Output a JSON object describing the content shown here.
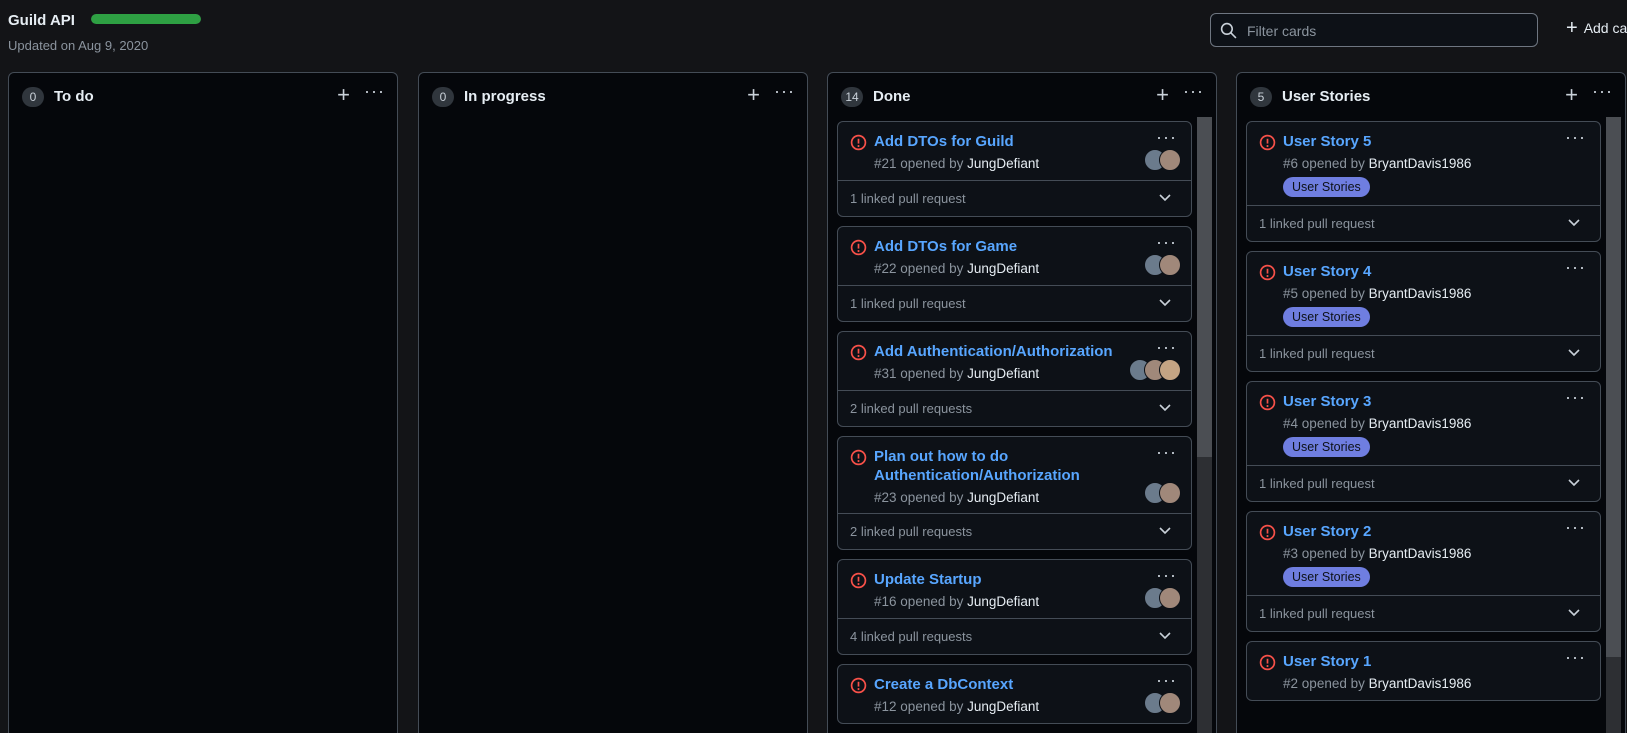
{
  "header": {
    "title": "Guild API",
    "progress": 1.0,
    "updated": "Updated on Aug 9, 2020",
    "filter_placeholder": "Filter cards",
    "add_cards": "Add cards"
  },
  "colors": {
    "accent": "#58a6ff",
    "progress": "#2ea043",
    "issue_icon": "#f85149",
    "label_bg": "#6f7ee0"
  },
  "columns": [
    {
      "count": "0",
      "name": "To do",
      "cards": []
    },
    {
      "count": "0",
      "name": "In progress",
      "cards": []
    },
    {
      "count": "14",
      "name": "Done",
      "cards": [
        {
          "title": "Add DTOs for Guild",
          "number": "#21",
          "opened_by": "opened by",
          "author": "JungDefiant",
          "linked": "1 linked pull request"
        },
        {
          "title": "Add DTOs for Game",
          "number": "#22",
          "opened_by": "opened by",
          "author": "JungDefiant",
          "linked": "1 linked pull request"
        },
        {
          "title": "Add Authentication/Authorization",
          "number": "#31",
          "opened_by": "opened by",
          "author": "JungDefiant",
          "linked": "2 linked pull requests"
        },
        {
          "title": "Plan out how to do Authentication/Authorization",
          "number": "#23",
          "opened_by": "opened by",
          "author": "JungDefiant",
          "linked": "2 linked pull requests"
        },
        {
          "title": "Update Startup",
          "number": "#16",
          "opened_by": "opened by",
          "author": "JungDefiant",
          "linked": "4 linked pull requests"
        },
        {
          "title": "Create a DbContext",
          "number": "#12",
          "opened_by": "opened by",
          "author": "JungDefiant",
          "linked": ""
        }
      ]
    },
    {
      "count": "5",
      "name": "User Stories",
      "cards": [
        {
          "title": "User Story 5",
          "number": "#6",
          "opened_by": "opened by",
          "author": "BryantDavis1986",
          "label": "User Stories",
          "linked": "1 linked pull request"
        },
        {
          "title": "User Story 4",
          "number": "#5",
          "opened_by": "opened by",
          "author": "BryantDavis1986",
          "label": "User Stories",
          "linked": "1 linked pull request"
        },
        {
          "title": "User Story 3",
          "number": "#4",
          "opened_by": "opened by",
          "author": "BryantDavis1986",
          "label": "User Stories",
          "linked": "1 linked pull request"
        },
        {
          "title": "User Story 2",
          "number": "#3",
          "opened_by": "opened by",
          "author": "BryantDavis1986",
          "label": "User Stories",
          "linked": "1 linked pull request"
        },
        {
          "title": "User Story 1",
          "number": "#2",
          "opened_by": "opened by",
          "author": "BryantDavis1986",
          "label": "",
          "linked": ""
        }
      ]
    }
  ]
}
